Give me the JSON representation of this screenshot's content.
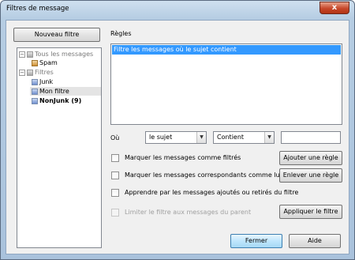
{
  "window": {
    "title": "Filtres de message",
    "close_glyph": "x"
  },
  "left": {
    "new_filter_button": "Nouveau filtre",
    "tree": {
      "all_messages": {
        "label": "Tous les messages",
        "children": [
          {
            "label": "Spam"
          }
        ]
      },
      "filters": {
        "label": "Filtres",
        "children": [
          {
            "label": "Junk"
          },
          {
            "label": "Mon filtre"
          },
          {
            "label": "NonJunk (9)"
          }
        ]
      }
    }
  },
  "rules": {
    "heading": "Règles",
    "items": [
      "Filtre les messages où le sujet contient"
    ]
  },
  "condition": {
    "where_label": "Où",
    "field_value": "le sujet",
    "operator_value": "Contient",
    "text_value": ""
  },
  "options": {
    "mark_filtered": "Marquer les messages comme filtrés",
    "mark_read": "Marquer les messages correspondants comme lus",
    "learn": "Apprendre par les messages ajoutés ou retirés du filtre",
    "limit_parent": "Limiter le filtre aux messages du parent"
  },
  "buttons": {
    "add_rule": "Ajouter une règle",
    "remove_rule": "Enlever une règle",
    "apply_filter": "Appliquer le filtre",
    "close": "Fermer",
    "help": "Aide"
  }
}
